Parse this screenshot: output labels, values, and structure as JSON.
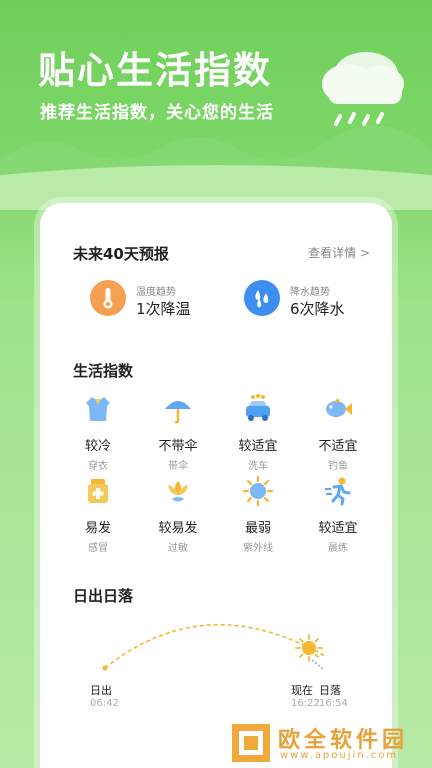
{
  "hero": {
    "title": "贴心生活指数",
    "subtitle": "推荐生活指数，关心您的生活"
  },
  "forecast": {
    "title": "未来40天预报",
    "detail_link": "查看详情 >",
    "temp": {
      "label": "温度趋势",
      "value": "1次降温"
    },
    "rain": {
      "label": "降水趋势",
      "value": "6次降水"
    }
  },
  "life": {
    "title": "生活指数",
    "items": [
      {
        "value": "较冷",
        "label": "穿衣",
        "icon": "shirt-icon"
      },
      {
        "value": "不带伞",
        "label": "带伞",
        "icon": "umbrella-icon"
      },
      {
        "value": "较适宜",
        "label": "洗车",
        "icon": "car-wash-icon"
      },
      {
        "value": "不适宜",
        "label": "钓鱼",
        "icon": "fish-icon"
      },
      {
        "value": "易发",
        "label": "感冒",
        "icon": "medicine-icon"
      },
      {
        "value": "较易发",
        "label": "过敏",
        "icon": "flower-icon"
      },
      {
        "value": "最弱",
        "label": "紫外线",
        "icon": "sun-icon"
      },
      {
        "value": "较适宜",
        "label": "晨练",
        "icon": "running-icon"
      }
    ]
  },
  "sun": {
    "title": "日出日落",
    "sunrise_label": "日出",
    "sunrise_time": "06:42",
    "now_label": "现在",
    "sunset_label": "日落",
    "now_time": "16:22",
    "sunset_time": "16:54"
  },
  "watermark": {
    "text": "欧全软件园",
    "url": "www.apoujin.com"
  },
  "colors": {
    "temp_icon": "#f5a052",
    "rain_icon": "#3d8ef0",
    "arc": "#f2b930"
  }
}
